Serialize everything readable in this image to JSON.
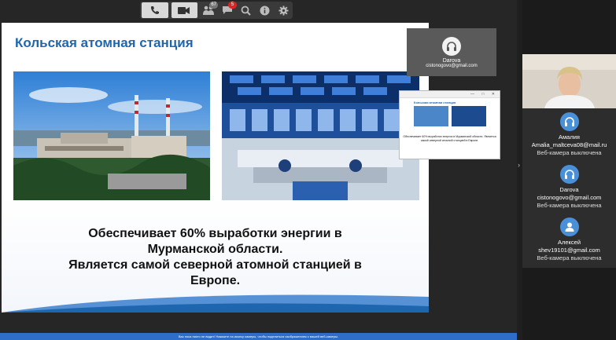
{
  "toolbar": {
    "chat_badge": "67",
    "msg_badge": "5",
    "buttons": [
      "phone-icon",
      "camera-icon",
      "participants-icon",
      "chat-icon",
      "search-icon",
      "info-icon",
      "gear-icon"
    ]
  },
  "slide": {
    "title": "Кольская атомная станция",
    "text_lines": [
      "Обеспечивает 60% выработки энергии в",
      "Мурманской области.",
      "Является самой северной атомной станцией в",
      "Европе."
    ]
  },
  "tile": {
    "name": "Darova",
    "email": "cistonogovo@gmail.com"
  },
  "mini_window": {
    "title": "Кольская атомная станция",
    "text": "Обеспечивает 60% выработки энергии в Мурманской области. Является самой северной атомной станцией в Европе."
  },
  "participants": [
    {
      "name": "Амалия",
      "email": "Amalia_maltceva08@mail.ru",
      "status": "Веб-камера выключена"
    },
    {
      "name": "Darova",
      "email": "cistonogovo@gmail.com",
      "status": "Веб-камера выключена"
    },
    {
      "name": "Алексей",
      "email": "shev19101@gmail.com",
      "status": "Веб-камера выключена"
    }
  ],
  "notice": "Вас пока никто не видит! Нажмите на иконку камеры, чтобы поделиться изображением с вашей веб-камеры.",
  "colors": {
    "accent": "#1e66b0",
    "avatar": "#4a90d9",
    "notice_bar": "#2f6ec8"
  }
}
